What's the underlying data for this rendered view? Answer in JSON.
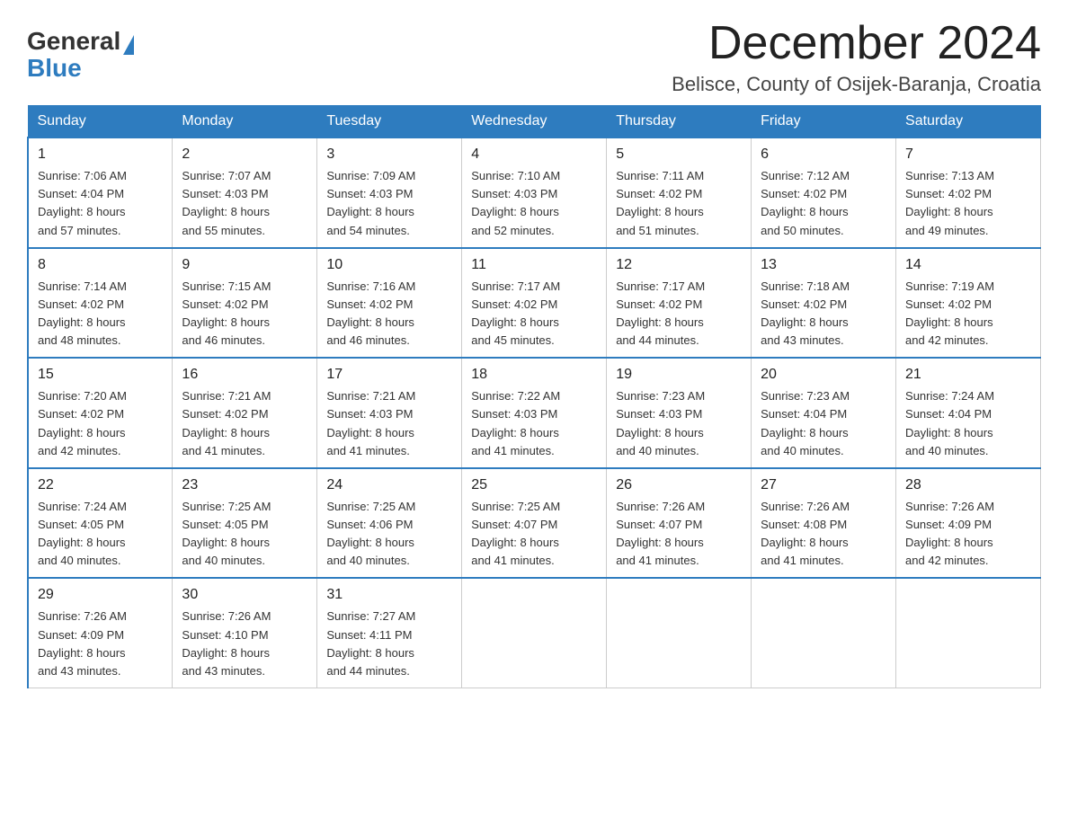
{
  "header": {
    "logo_general": "General",
    "logo_blue": "Blue",
    "month_title": "December 2024",
    "location": "Belisce, County of Osijek-Baranja, Croatia"
  },
  "days_of_week": [
    "Sunday",
    "Monday",
    "Tuesday",
    "Wednesday",
    "Thursday",
    "Friday",
    "Saturday"
  ],
  "weeks": [
    [
      {
        "day": "1",
        "sunrise": "7:06 AM",
        "sunset": "4:04 PM",
        "daylight": "8 hours and 57 minutes."
      },
      {
        "day": "2",
        "sunrise": "7:07 AM",
        "sunset": "4:03 PM",
        "daylight": "8 hours and 55 minutes."
      },
      {
        "day": "3",
        "sunrise": "7:09 AM",
        "sunset": "4:03 PM",
        "daylight": "8 hours and 54 minutes."
      },
      {
        "day": "4",
        "sunrise": "7:10 AM",
        "sunset": "4:03 PM",
        "daylight": "8 hours and 52 minutes."
      },
      {
        "day": "5",
        "sunrise": "7:11 AM",
        "sunset": "4:02 PM",
        "daylight": "8 hours and 51 minutes."
      },
      {
        "day": "6",
        "sunrise": "7:12 AM",
        "sunset": "4:02 PM",
        "daylight": "8 hours and 50 minutes."
      },
      {
        "day": "7",
        "sunrise": "7:13 AM",
        "sunset": "4:02 PM",
        "daylight": "8 hours and 49 minutes."
      }
    ],
    [
      {
        "day": "8",
        "sunrise": "7:14 AM",
        "sunset": "4:02 PM",
        "daylight": "8 hours and 48 minutes."
      },
      {
        "day": "9",
        "sunrise": "7:15 AM",
        "sunset": "4:02 PM",
        "daylight": "8 hours and 46 minutes."
      },
      {
        "day": "10",
        "sunrise": "7:16 AM",
        "sunset": "4:02 PM",
        "daylight": "8 hours and 46 minutes."
      },
      {
        "day": "11",
        "sunrise": "7:17 AM",
        "sunset": "4:02 PM",
        "daylight": "8 hours and 45 minutes."
      },
      {
        "day": "12",
        "sunrise": "7:17 AM",
        "sunset": "4:02 PM",
        "daylight": "8 hours and 44 minutes."
      },
      {
        "day": "13",
        "sunrise": "7:18 AM",
        "sunset": "4:02 PM",
        "daylight": "8 hours and 43 minutes."
      },
      {
        "day": "14",
        "sunrise": "7:19 AM",
        "sunset": "4:02 PM",
        "daylight": "8 hours and 42 minutes."
      }
    ],
    [
      {
        "day": "15",
        "sunrise": "7:20 AM",
        "sunset": "4:02 PM",
        "daylight": "8 hours and 42 minutes."
      },
      {
        "day": "16",
        "sunrise": "7:21 AM",
        "sunset": "4:02 PM",
        "daylight": "8 hours and 41 minutes."
      },
      {
        "day": "17",
        "sunrise": "7:21 AM",
        "sunset": "4:03 PM",
        "daylight": "8 hours and 41 minutes."
      },
      {
        "day": "18",
        "sunrise": "7:22 AM",
        "sunset": "4:03 PM",
        "daylight": "8 hours and 41 minutes."
      },
      {
        "day": "19",
        "sunrise": "7:23 AM",
        "sunset": "4:03 PM",
        "daylight": "8 hours and 40 minutes."
      },
      {
        "day": "20",
        "sunrise": "7:23 AM",
        "sunset": "4:04 PM",
        "daylight": "8 hours and 40 minutes."
      },
      {
        "day": "21",
        "sunrise": "7:24 AM",
        "sunset": "4:04 PM",
        "daylight": "8 hours and 40 minutes."
      }
    ],
    [
      {
        "day": "22",
        "sunrise": "7:24 AM",
        "sunset": "4:05 PM",
        "daylight": "8 hours and 40 minutes."
      },
      {
        "day": "23",
        "sunrise": "7:25 AM",
        "sunset": "4:05 PM",
        "daylight": "8 hours and 40 minutes."
      },
      {
        "day": "24",
        "sunrise": "7:25 AM",
        "sunset": "4:06 PM",
        "daylight": "8 hours and 40 minutes."
      },
      {
        "day": "25",
        "sunrise": "7:25 AM",
        "sunset": "4:07 PM",
        "daylight": "8 hours and 41 minutes."
      },
      {
        "day": "26",
        "sunrise": "7:26 AM",
        "sunset": "4:07 PM",
        "daylight": "8 hours and 41 minutes."
      },
      {
        "day": "27",
        "sunrise": "7:26 AM",
        "sunset": "4:08 PM",
        "daylight": "8 hours and 41 minutes."
      },
      {
        "day": "28",
        "sunrise": "7:26 AM",
        "sunset": "4:09 PM",
        "daylight": "8 hours and 42 minutes."
      }
    ],
    [
      {
        "day": "29",
        "sunrise": "7:26 AM",
        "sunset": "4:09 PM",
        "daylight": "8 hours and 43 minutes."
      },
      {
        "day": "30",
        "sunrise": "7:26 AM",
        "sunset": "4:10 PM",
        "daylight": "8 hours and 43 minutes."
      },
      {
        "day": "31",
        "sunrise": "7:27 AM",
        "sunset": "4:11 PM",
        "daylight": "8 hours and 44 minutes."
      },
      null,
      null,
      null,
      null
    ]
  ],
  "labels": {
    "sunrise": "Sunrise:",
    "sunset": "Sunset:",
    "daylight": "Daylight:"
  }
}
